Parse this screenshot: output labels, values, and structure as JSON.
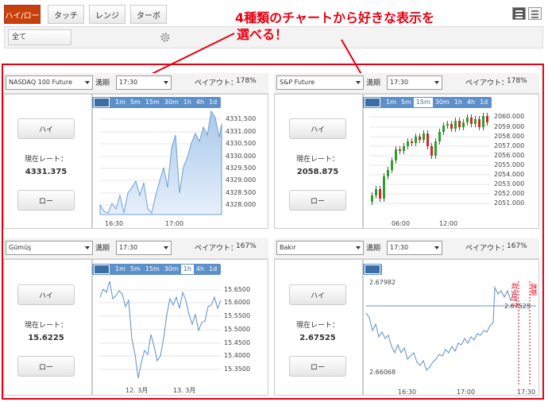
{
  "tabs": [
    "ハイ/ロー",
    "タッチ",
    "レンジ",
    "ターボ"
  ],
  "filter": "全て",
  "annotation": {
    "line1": "4種類のチャートから好きな表示を",
    "line2": "選べる！"
  },
  "labels": {
    "expiry": "満期",
    "payout": "ペイアウト：",
    "current_rate": "現在レート：",
    "high": "ハイ",
    "low": "ロー"
  },
  "icons": {
    "settings": "gear-icon",
    "grid_view": "grid-view-icon",
    "list_view": "list-view-icon",
    "chart_type": "chart-type-icon"
  },
  "panels": [
    {
      "asset": "NASDAQ 100 Future",
      "time": "17:30",
      "payout": "178%",
      "rate": "4331.375",
      "timeframes": [
        "1m",
        "5m",
        "15m",
        "30m",
        "1h",
        "4h",
        "1d"
      ],
      "active_tf": "",
      "y_ticks": [
        "4331.500",
        "4331.000",
        "4330.500",
        "4330.000",
        "4329.500",
        "4329.000",
        "4328.500",
        "4328.000"
      ],
      "x_ticks": [
        "16:30",
        "17:00"
      ]
    },
    {
      "asset": "S&P Future",
      "time": "17:30",
      "payout": "178%",
      "rate": "2058.875",
      "timeframes": [
        "1m",
        "5m",
        "15m",
        "30m",
        "1h",
        "4h",
        "1d"
      ],
      "active_tf": "15m",
      "y_ticks": [
        "2060.000",
        "2059.000",
        "2058.000",
        "2057.000",
        "2056.000",
        "2055.000",
        "2054.000",
        "2053.000",
        "2052.000",
        "2051.000"
      ],
      "x_ticks": [
        "06:00",
        "12:00"
      ]
    },
    {
      "asset": "Gümüş",
      "time": "17:30",
      "payout": "167%",
      "rate": "15.6225",
      "timeframes": [
        "1m",
        "5m",
        "15m",
        "30m",
        "1h",
        "4h",
        "1d"
      ],
      "active_tf": "1h",
      "y_ticks": [
        "15.6500",
        "15.6000",
        "15.5500",
        "15.5000",
        "15.4500",
        "15.4000",
        "15.3500"
      ],
      "x_ticks": [
        "12. 3月",
        "13. 3月"
      ]
    },
    {
      "asset": "Bakır",
      "time": "17:30",
      "payout": "167%",
      "rate": "2.67525",
      "timeframes": [],
      "active_tf": "",
      "y_ticks": [],
      "x_ticks": [
        "16:30",
        "17:00",
        "17:30"
      ],
      "top_label": "2.67982",
      "bottom_label": "2.66068",
      "current_label": "2.67525",
      "vlabels": [
        "取引終了",
        "満期"
      ]
    }
  ],
  "colors": {
    "accent": "#c8400a",
    "annotation": "#e60012",
    "chart_blue": "#5d8fc9"
  }
}
